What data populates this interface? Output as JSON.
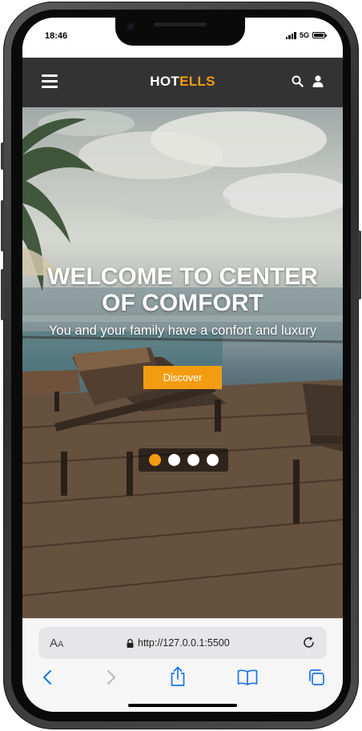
{
  "status": {
    "time": "18:46",
    "network": "5G"
  },
  "navbar": {
    "brand_part1": "HOT",
    "brand_part2": "ELLS"
  },
  "hero": {
    "title": "WELCOME TO CENTER OF COMFORT",
    "subtitle": "You and your family have a confort and luxury",
    "cta_label": "Discover",
    "slides": 4,
    "active_slide": 1
  },
  "browser": {
    "text_size_label_big": "A",
    "text_size_label_small": "A",
    "url": "http://127.0.0.1:5500"
  },
  "colors": {
    "accent": "#f39c12",
    "navbar": "#333333",
    "ios_blue": "#1a73e8"
  },
  "icons": [
    "menu-icon",
    "search-icon",
    "user-icon",
    "lock-icon",
    "reload-icon",
    "back-icon",
    "forward-icon",
    "share-icon",
    "bookmarks-icon",
    "tabs-icon"
  ]
}
